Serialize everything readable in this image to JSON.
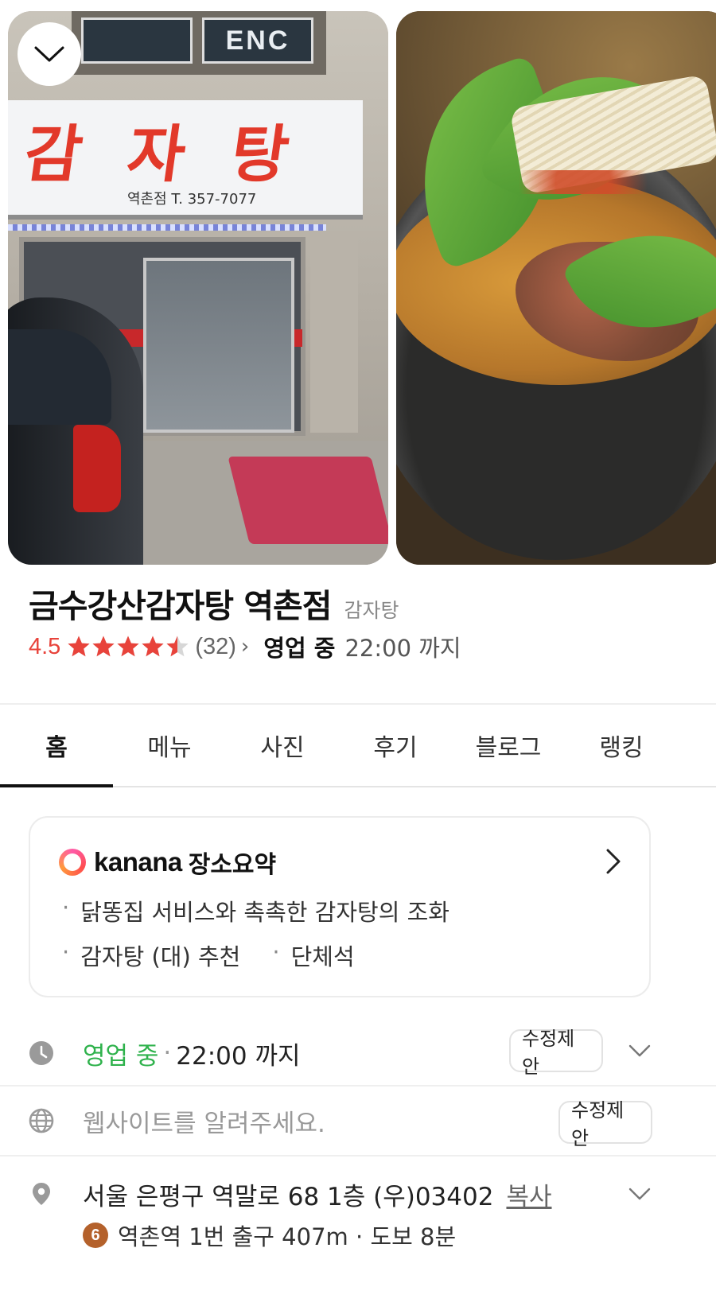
{
  "header": {
    "collapse_icon": "chevron-down-icon"
  },
  "photos": {
    "storefront": {
      "sign_main": "감자탕",
      "sign_sub": "역촌점 T. 357-7077",
      "upper_sign": "ENC"
    }
  },
  "place": {
    "name": "금수강산감자탕 역촌점",
    "category": "감자탕",
    "rating": "4.5",
    "rating_value": 4.5,
    "rating_max": 5,
    "review_count": "(32)",
    "open_status": "영업 중",
    "open_until": "22:00 까지",
    "star_color": "#e8433b"
  },
  "tabs": [
    {
      "label": "홈",
      "active": true
    },
    {
      "label": "메뉴",
      "active": false
    },
    {
      "label": "사진",
      "active": false
    },
    {
      "label": "후기",
      "active": false
    },
    {
      "label": "블로그",
      "active": false
    },
    {
      "label": "랭킹",
      "active": false
    }
  ],
  "summary": {
    "brand": "kanana",
    "label": "장소요약",
    "lines": [
      [
        "닭똥집 서비스와 촉촉한 감자탕의 조화"
      ],
      [
        "감자탕 (대) 추천",
        "단체석"
      ]
    ]
  },
  "info": {
    "hours": {
      "status": "영업 중",
      "separator": "·",
      "until": "22:00 까지",
      "edit_label": "수정제안",
      "status_color": "#2fb24c"
    },
    "website": {
      "placeholder": "웹사이트를 알려주세요.",
      "edit_label": "수정제안"
    },
    "address": {
      "text": "서울 은평구 역말로 68 1층 (우)03402",
      "copy_label": "복사"
    },
    "subway": {
      "line": "6",
      "text": "역촌역 1번 출구 407m · 도보 8분",
      "line_color": "#b4612b"
    }
  }
}
